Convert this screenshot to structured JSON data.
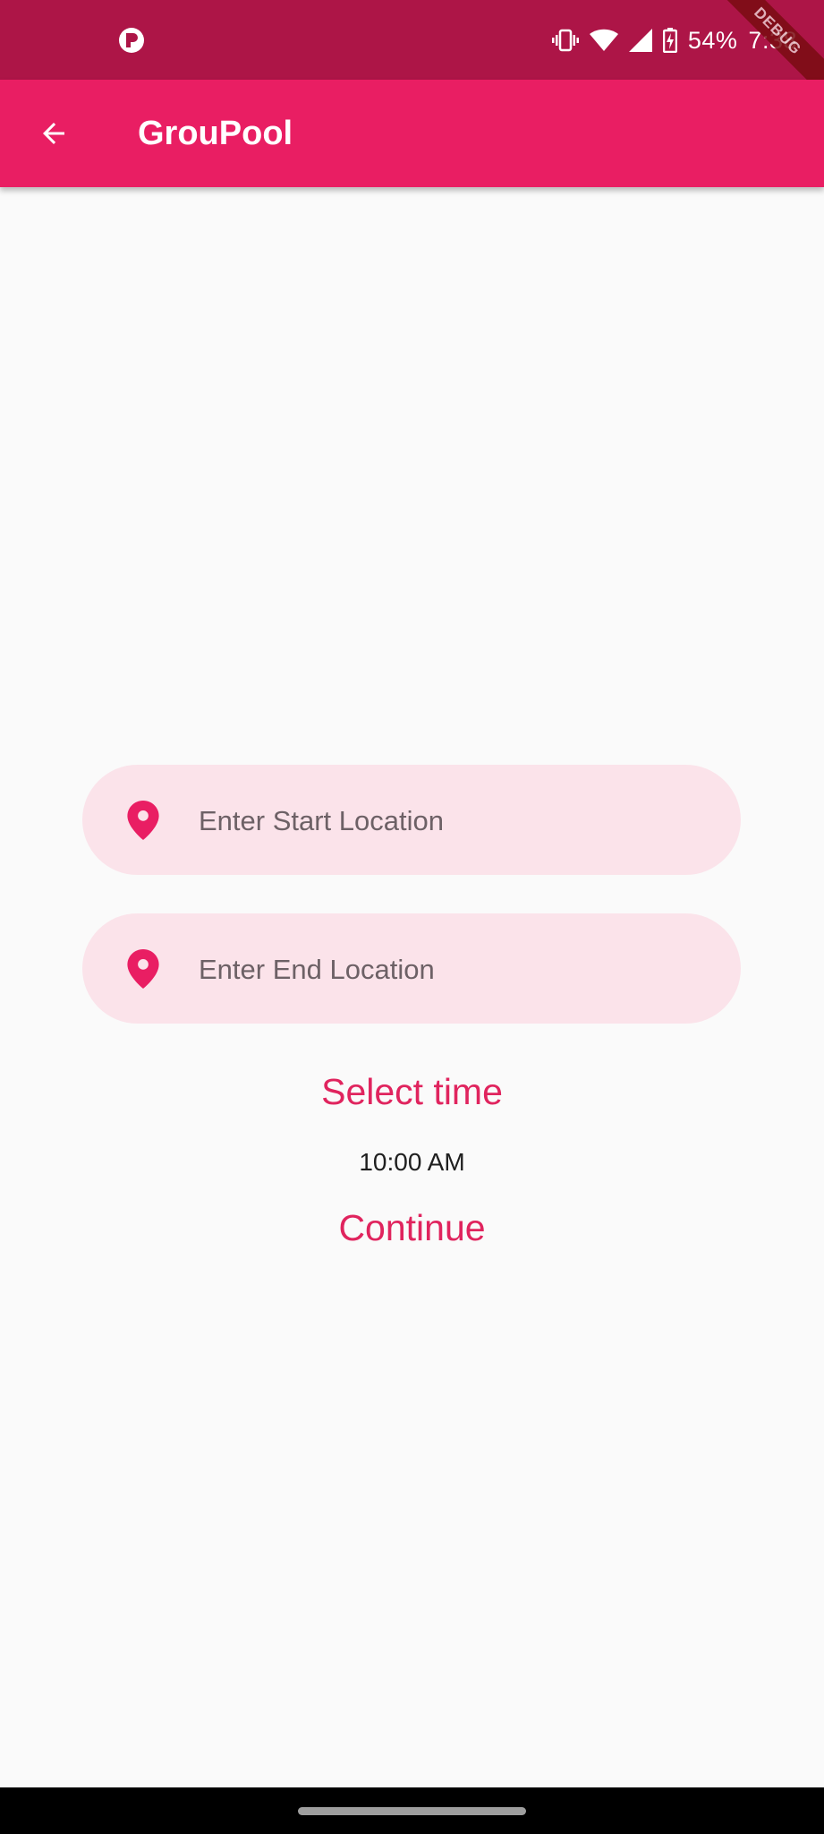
{
  "status_bar": {
    "battery": "54%",
    "time": "7:38",
    "debug_label": "DEBUG",
    "icons": [
      "app-notification-icon",
      "vibrate-icon",
      "wifi-icon",
      "cell-signal-icon",
      "battery-charging-icon"
    ],
    "background": "#ad1547"
  },
  "app_bar": {
    "title": "GrouPool",
    "back_icon": "arrow-back-icon",
    "background": "#e91e63"
  },
  "form": {
    "start_location": {
      "placeholder": "Enter Start Location",
      "value": "",
      "icon": "location-pin-icon"
    },
    "end_location": {
      "placeholder": "Enter End Location",
      "value": "",
      "icon": "location-pin-icon"
    },
    "select_time_label": "Select time",
    "selected_time": "10:00 AM",
    "continue_label": "Continue",
    "accent": "#e0245e",
    "field_background": "#fbe3ea"
  }
}
